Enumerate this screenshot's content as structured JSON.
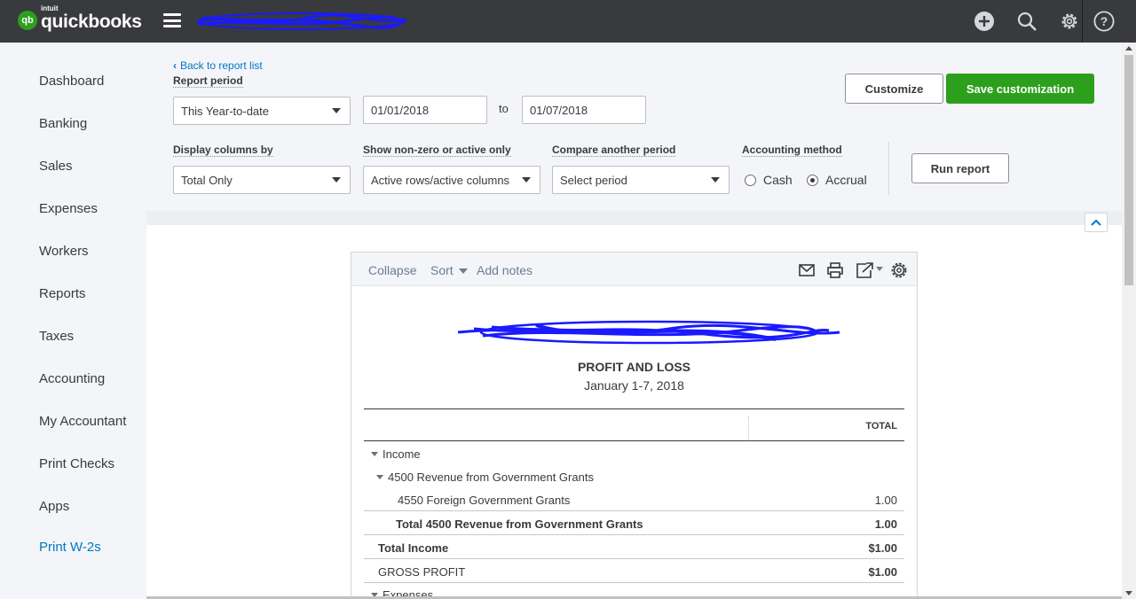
{
  "app": {
    "brand": "quickbooks",
    "brand_prefix": "intuit",
    "logo_mark": "qb"
  },
  "topbar": {
    "icons": [
      "plus-circle-icon",
      "search-icon",
      "gear-icon",
      "help-icon"
    ]
  },
  "sidebar": {
    "items": [
      {
        "label": "Dashboard"
      },
      {
        "label": "Banking"
      },
      {
        "label": "Sales"
      },
      {
        "label": "Expenses"
      },
      {
        "label": "Workers"
      },
      {
        "label": "Reports"
      },
      {
        "label": "Taxes"
      },
      {
        "label": "Accounting"
      },
      {
        "label": "My Accountant"
      },
      {
        "label": "Print Checks"
      },
      {
        "label": "Apps"
      },
      {
        "label": "Print W-2s"
      }
    ],
    "active_color": "#0077c5"
  },
  "header": {
    "back_link": "Back to report list",
    "report_period_label": "Report period",
    "report_period_value": "This Year-to-date",
    "date_from": "01/01/2018",
    "to_label": "to",
    "date_to": "01/07/2018",
    "customize_label": "Customize",
    "save_label": "Save customization",
    "display_columns_label": "Display columns by",
    "display_columns_value": "Total Only",
    "nonzero_label": "Show non-zero or active only",
    "nonzero_value": "Active rows/active columns",
    "compare_label": "Compare another period",
    "compare_value": "Select period",
    "accounting_method_label": "Accounting method",
    "cash_label": "Cash",
    "accrual_label": "Accrual",
    "accounting_method_selected": "Accrual",
    "run_report_label": "Run report"
  },
  "report": {
    "toolbar": {
      "collapse": "Collapse",
      "sort": "Sort",
      "add_notes": "Add notes",
      "icons": [
        "email-icon",
        "print-icon",
        "export-icon",
        "settings-icon"
      ]
    },
    "title": "PROFIT AND LOSS",
    "date_range": "January 1-7, 2018",
    "column_header": "TOTAL",
    "rows": [
      {
        "label": "Income",
        "amount": ""
      },
      {
        "label": "4500 Revenue from Government Grants",
        "amount": ""
      },
      {
        "label": "4550 Foreign Government Grants",
        "amount": "1.00"
      },
      {
        "label": "Total 4500 Revenue from Government Grants",
        "amount": "1.00"
      },
      {
        "label": "Total Income",
        "amount": "$1.00"
      },
      {
        "label": "GROSS PROFIT",
        "amount": "$1.00"
      },
      {
        "label": "Expenses",
        "amount": ""
      }
    ]
  },
  "colors": {
    "topbar": "#393a3d",
    "primary_button": "#2ca01c",
    "link": "#0077c5",
    "redaction_scribble": "#1a1aff"
  }
}
